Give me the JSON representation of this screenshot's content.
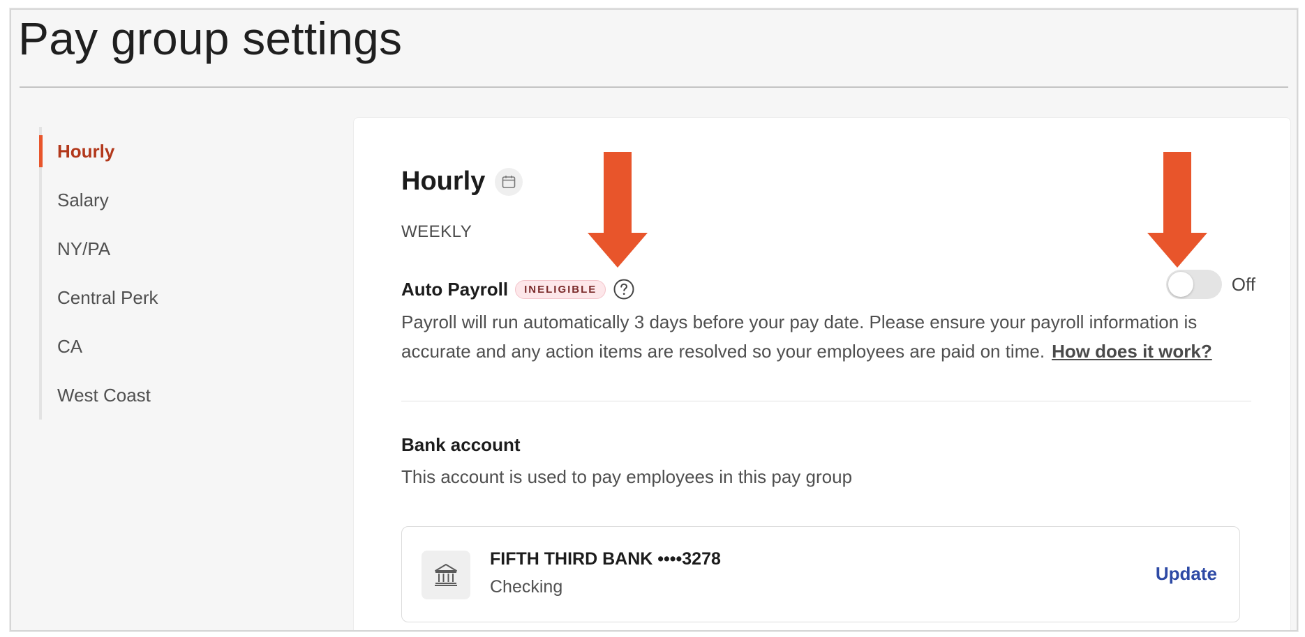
{
  "page": {
    "title": "Pay group settings"
  },
  "sidebar": {
    "items": [
      {
        "label": "Hourly",
        "active": true
      },
      {
        "label": "Salary",
        "active": false
      },
      {
        "label": "NY/PA",
        "active": false
      },
      {
        "label": "Central Perk",
        "active": false
      },
      {
        "label": "CA",
        "active": false
      },
      {
        "label": "West Coast",
        "active": false
      }
    ]
  },
  "card": {
    "title": "Hourly",
    "title_icon": "calendar-icon",
    "frequency": "WEEKLY",
    "auto_payroll": {
      "label": "Auto Payroll",
      "badge": "INELIGIBLE",
      "help_icon": "question-circle-icon",
      "toggle_state": "Off",
      "description": "Payroll will run automatically 3 days before your pay date. Please ensure your payroll information is accurate and any action items are resolved so your employees are paid on time.",
      "link_text": "How does it work?"
    },
    "bank": {
      "title": "Bank account",
      "description": "This account is used to pay employees in this pay group",
      "icon": "bank-icon",
      "name": "FIFTH THIRD BANK ••••3278",
      "type": "Checking",
      "update_label": "Update"
    }
  },
  "annotations": {
    "arrow_icon": "down-arrow-icon",
    "arrow_color": "#e8552b"
  },
  "colors": {
    "accent": "#e8552b",
    "active_nav_text": "#b2381b",
    "link_blue": "#2e4aa5",
    "badge_bg": "#fde7ea"
  }
}
